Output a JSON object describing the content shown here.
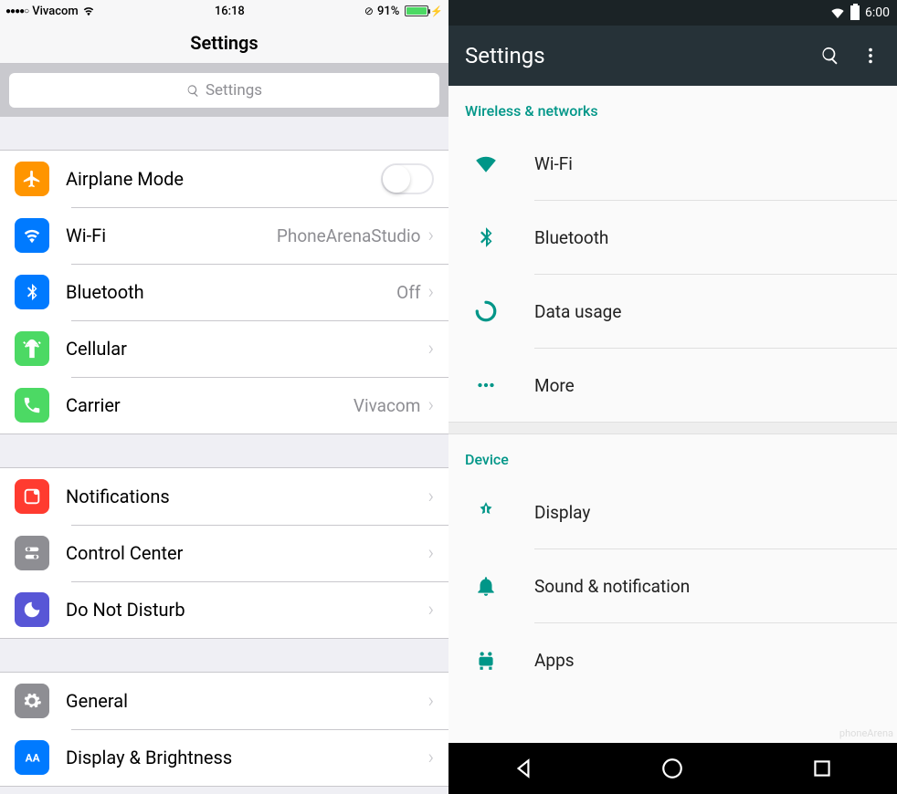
{
  "ios": {
    "status": {
      "carrier": "Vivacom",
      "time": "16:18",
      "battery_pct": "91%"
    },
    "title": "Settings",
    "search_placeholder": "Settings",
    "group1": [
      {
        "label": "Airplane Mode",
        "detail": "",
        "icon": "airplane",
        "bg": "#ff9500",
        "control": "toggle-off"
      },
      {
        "label": "Wi-Fi",
        "detail": "PhoneArenaStudio",
        "icon": "wifi",
        "bg": "#007aff",
        "control": "chevron"
      },
      {
        "label": "Bluetooth",
        "detail": "Off",
        "icon": "bluetooth",
        "bg": "#007aff",
        "control": "chevron"
      },
      {
        "label": "Cellular",
        "detail": "",
        "icon": "cellular",
        "bg": "#4cd964",
        "control": "chevron"
      },
      {
        "label": "Carrier",
        "detail": "Vivacom",
        "icon": "phone",
        "bg": "#4cd964",
        "control": "chevron"
      }
    ],
    "group2": [
      {
        "label": "Notifications",
        "detail": "",
        "icon": "notifications",
        "bg": "#ff3b30",
        "control": "chevron"
      },
      {
        "label": "Control Center",
        "detail": "",
        "icon": "control-center",
        "bg": "#8e8e93",
        "control": "chevron"
      },
      {
        "label": "Do Not Disturb",
        "detail": "",
        "icon": "moon",
        "bg": "#5856d6",
        "control": "chevron"
      }
    ],
    "group3": [
      {
        "label": "General",
        "detail": "",
        "icon": "gear",
        "bg": "#8e8e93",
        "control": "chevron"
      },
      {
        "label": "Display & Brightness",
        "detail": "",
        "icon": "aa",
        "bg": "#007aff",
        "control": "chevron"
      }
    ]
  },
  "android": {
    "status": {
      "time": "6:00"
    },
    "title": "Settings",
    "section1_header": "Wireless & networks",
    "section1": [
      {
        "label": "Wi-Fi",
        "icon": "wifi"
      },
      {
        "label": "Bluetooth",
        "icon": "bluetooth"
      },
      {
        "label": "Data usage",
        "icon": "data"
      },
      {
        "label": "More",
        "icon": "more"
      }
    ],
    "section2_header": "Device",
    "section2": [
      {
        "label": "Display",
        "icon": "display"
      },
      {
        "label": "Sound & notification",
        "icon": "bell"
      },
      {
        "label": "Apps",
        "icon": "apps"
      }
    ],
    "watermark": "phoneArena"
  }
}
